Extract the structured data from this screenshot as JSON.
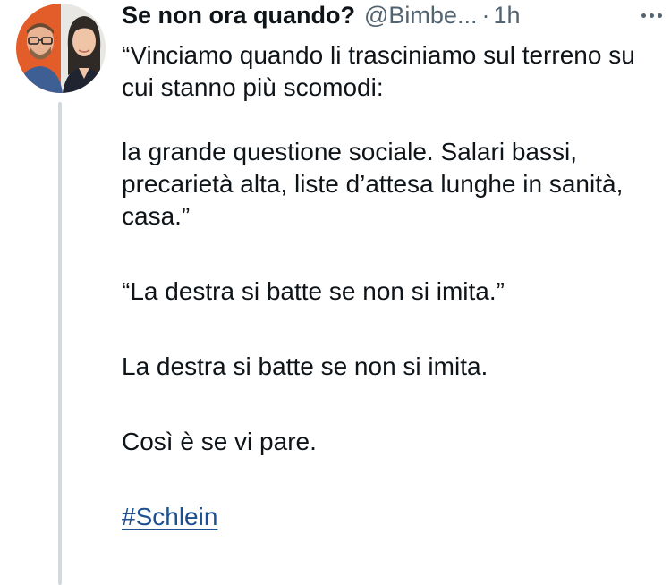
{
  "author": {
    "display_name": "Se non ora quando?",
    "handle": "@Bimbe...",
    "separator": "·",
    "time": "1h"
  },
  "icons": {
    "avatar": "avatar-two-people",
    "more": "more-horizontal-icon"
  },
  "tweet": {
    "paragraphs": [
      "“Vinciamo quando li trasciniamo sul terreno su cui stanno più scomodi:",
      "la grande questione sociale. Salari bassi, precarietà alta, liste d’attesa lunghe in sanità, casa.”",
      "“La destra si batte se non si imita.”",
      "La destra si batte se non si imita.",
      "Così è se vi pare."
    ],
    "hashtag": "#Schlein"
  },
  "colors": {
    "text": "#0f1419",
    "secondary": "#536471",
    "link": "#1d4f91",
    "thread_line": "#cfd9de"
  }
}
